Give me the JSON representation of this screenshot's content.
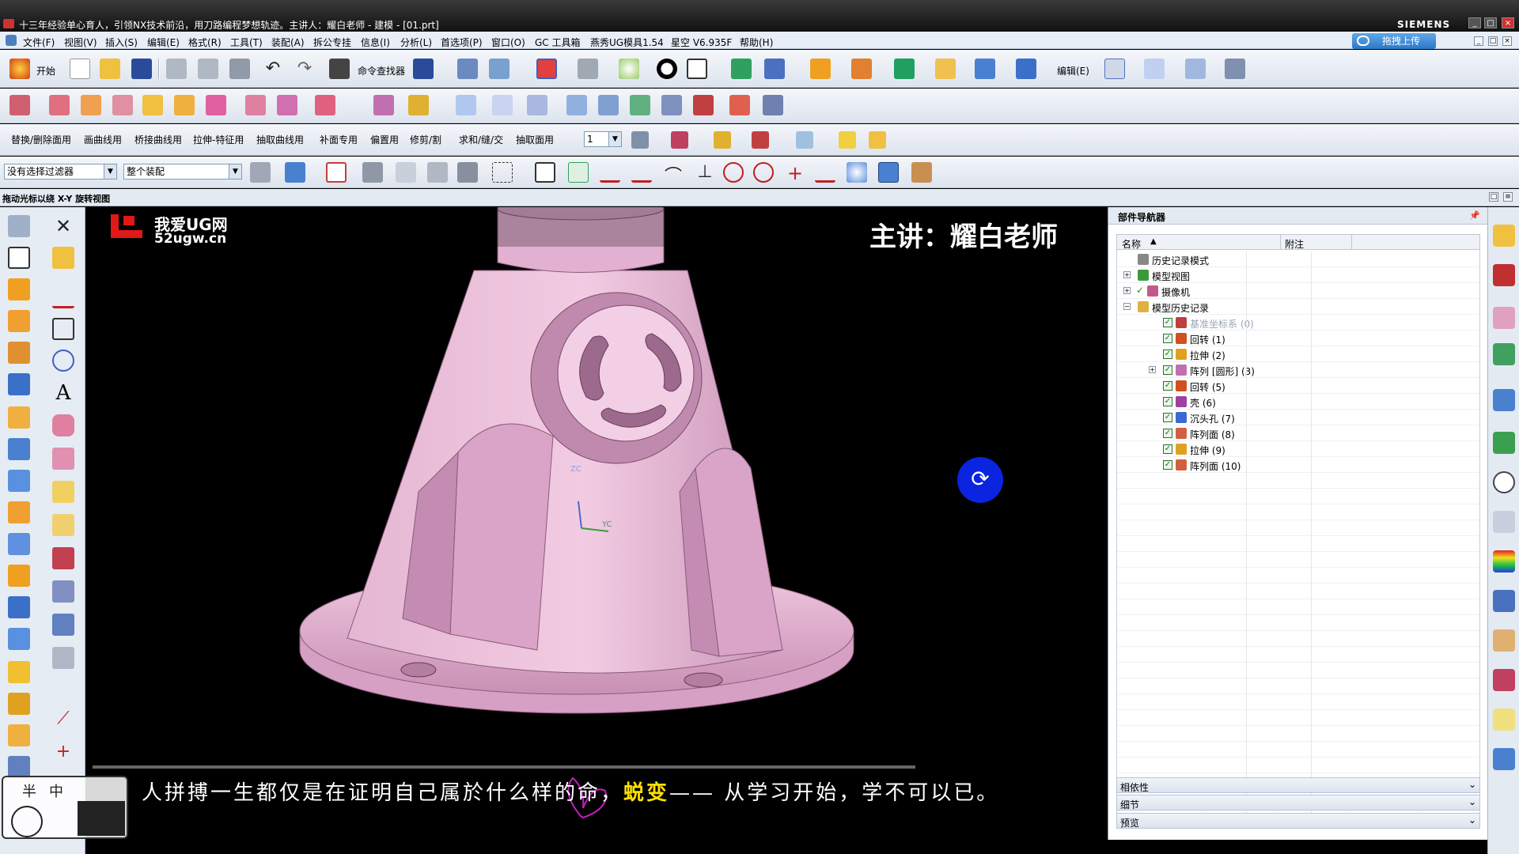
{
  "titlebar": {
    "title": "十三年经验单心育人，引领NX技术前沿，用刀路编程梦想轨迹。主讲人：耀白老师 - 建模 - [01.prt]",
    "brand": "SIEMENS",
    "min": "_",
    "max": "□",
    "close": "×"
  },
  "menubar": {
    "items": [
      "文件(F)",
      "视图(V)",
      "插入(S)",
      "编辑(E)",
      "格式(R)",
      "工具(T)",
      "装配(A)",
      "拆公专挂",
      "信息(I)",
      "分析(L)",
      "首选项(P)",
      "窗口(O)",
      "GC 工具箱",
      "燕秀UG模具1.54",
      "星空 V6.935F",
      "帮助(H)"
    ],
    "upload_label": "拖拽上传"
  },
  "toolbar1": {
    "start_label": "开始",
    "command_finder_label": "命令查找器",
    "edit_label": "编辑(E)"
  },
  "toolbar3": {
    "items": [
      "替换/删除面用",
      "画曲线用",
      "桥接曲线用",
      "拉伸-特征用",
      "抽取曲线用",
      "补面专用",
      "偏置用",
      "修剪/割",
      "求和/缝/交",
      "抽取面用"
    ],
    "spinner_value": "1"
  },
  "selection_bar": {
    "filter_value": "没有选择过滤器",
    "scope_value": "整个装配"
  },
  "status": {
    "text": "拖动光标以绕 X-Y 旋转视图"
  },
  "viewport": {
    "site_name": "我爱UG网",
    "site_url": "52ugw.cn",
    "lecturer": "主讲：耀白老师",
    "axis_zc": "ZC",
    "axis_yc": "YC",
    "subtitle_before": "人拼搏一生都仅是在证明自己属於什么样的命，",
    "subtitle_highlight": "蜕变",
    "subtitle_after": "—— 从学习开始，学不可以已。",
    "clock_chars": [
      "半",
      "中"
    ]
  },
  "navigator": {
    "title": "部件导航器",
    "col_name": "名称",
    "col_note": "附注",
    "rows": [
      {
        "label": "历史记录模式",
        "indent": 0,
        "expander": "",
        "check": false,
        "icon_color": "#888888",
        "dim": false
      },
      {
        "label": "模型视图",
        "indent": 0,
        "expander": "+",
        "check": false,
        "icon_color": "#3a9a3a",
        "dim": false
      },
      {
        "label": "摄像机",
        "indent": 0,
        "expander": "+",
        "check": true,
        "icon_color": "#c05a8a",
        "dim": false
      },
      {
        "label": "模型历史记录",
        "indent": 0,
        "expander": "−",
        "check": false,
        "icon_color": "#e0b040",
        "dim": false
      },
      {
        "label": "基准坐标系 (0)",
        "indent": 1,
        "expander": "",
        "check": true,
        "icon_color": "#c04040",
        "dim": true
      },
      {
        "label": "回转 (1)",
        "indent": 1,
        "expander": "",
        "check": true,
        "icon_color": "#d05020",
        "dim": false
      },
      {
        "label": "拉伸 (2)",
        "indent": 1,
        "expander": "",
        "check": true,
        "icon_color": "#e0a020",
        "dim": false
      },
      {
        "label": "阵列 [圆形] (3)",
        "indent": 1,
        "expander": "+",
        "check": true,
        "icon_color": "#c070b0",
        "dim": false
      },
      {
        "label": "回转 (5)",
        "indent": 1,
        "expander": "",
        "check": true,
        "icon_color": "#d05020",
        "dim": false
      },
      {
        "label": "壳 (6)",
        "indent": 1,
        "expander": "",
        "check": true,
        "icon_color": "#a040a0",
        "dim": false
      },
      {
        "label": "沉头孔 (7)",
        "indent": 1,
        "expander": "",
        "check": true,
        "icon_color": "#3a6ad0",
        "dim": false
      },
      {
        "label": "阵列面 (8)",
        "indent": 1,
        "expander": "",
        "check": true,
        "icon_color": "#d06040",
        "dim": false
      },
      {
        "label": "拉伸 (9)",
        "indent": 1,
        "expander": "",
        "check": true,
        "icon_color": "#e0a020",
        "dim": false
      },
      {
        "label": "阵列面 (10)",
        "indent": 1,
        "expander": "",
        "check": true,
        "icon_color": "#d06040",
        "dim": false
      }
    ],
    "sections": [
      "相依性",
      "细节",
      "预览"
    ]
  },
  "colors": {
    "part_pink": "#e8b4d4",
    "accent_blue": "#0a24e0",
    "subtitle_highlight": "#ffe000"
  }
}
